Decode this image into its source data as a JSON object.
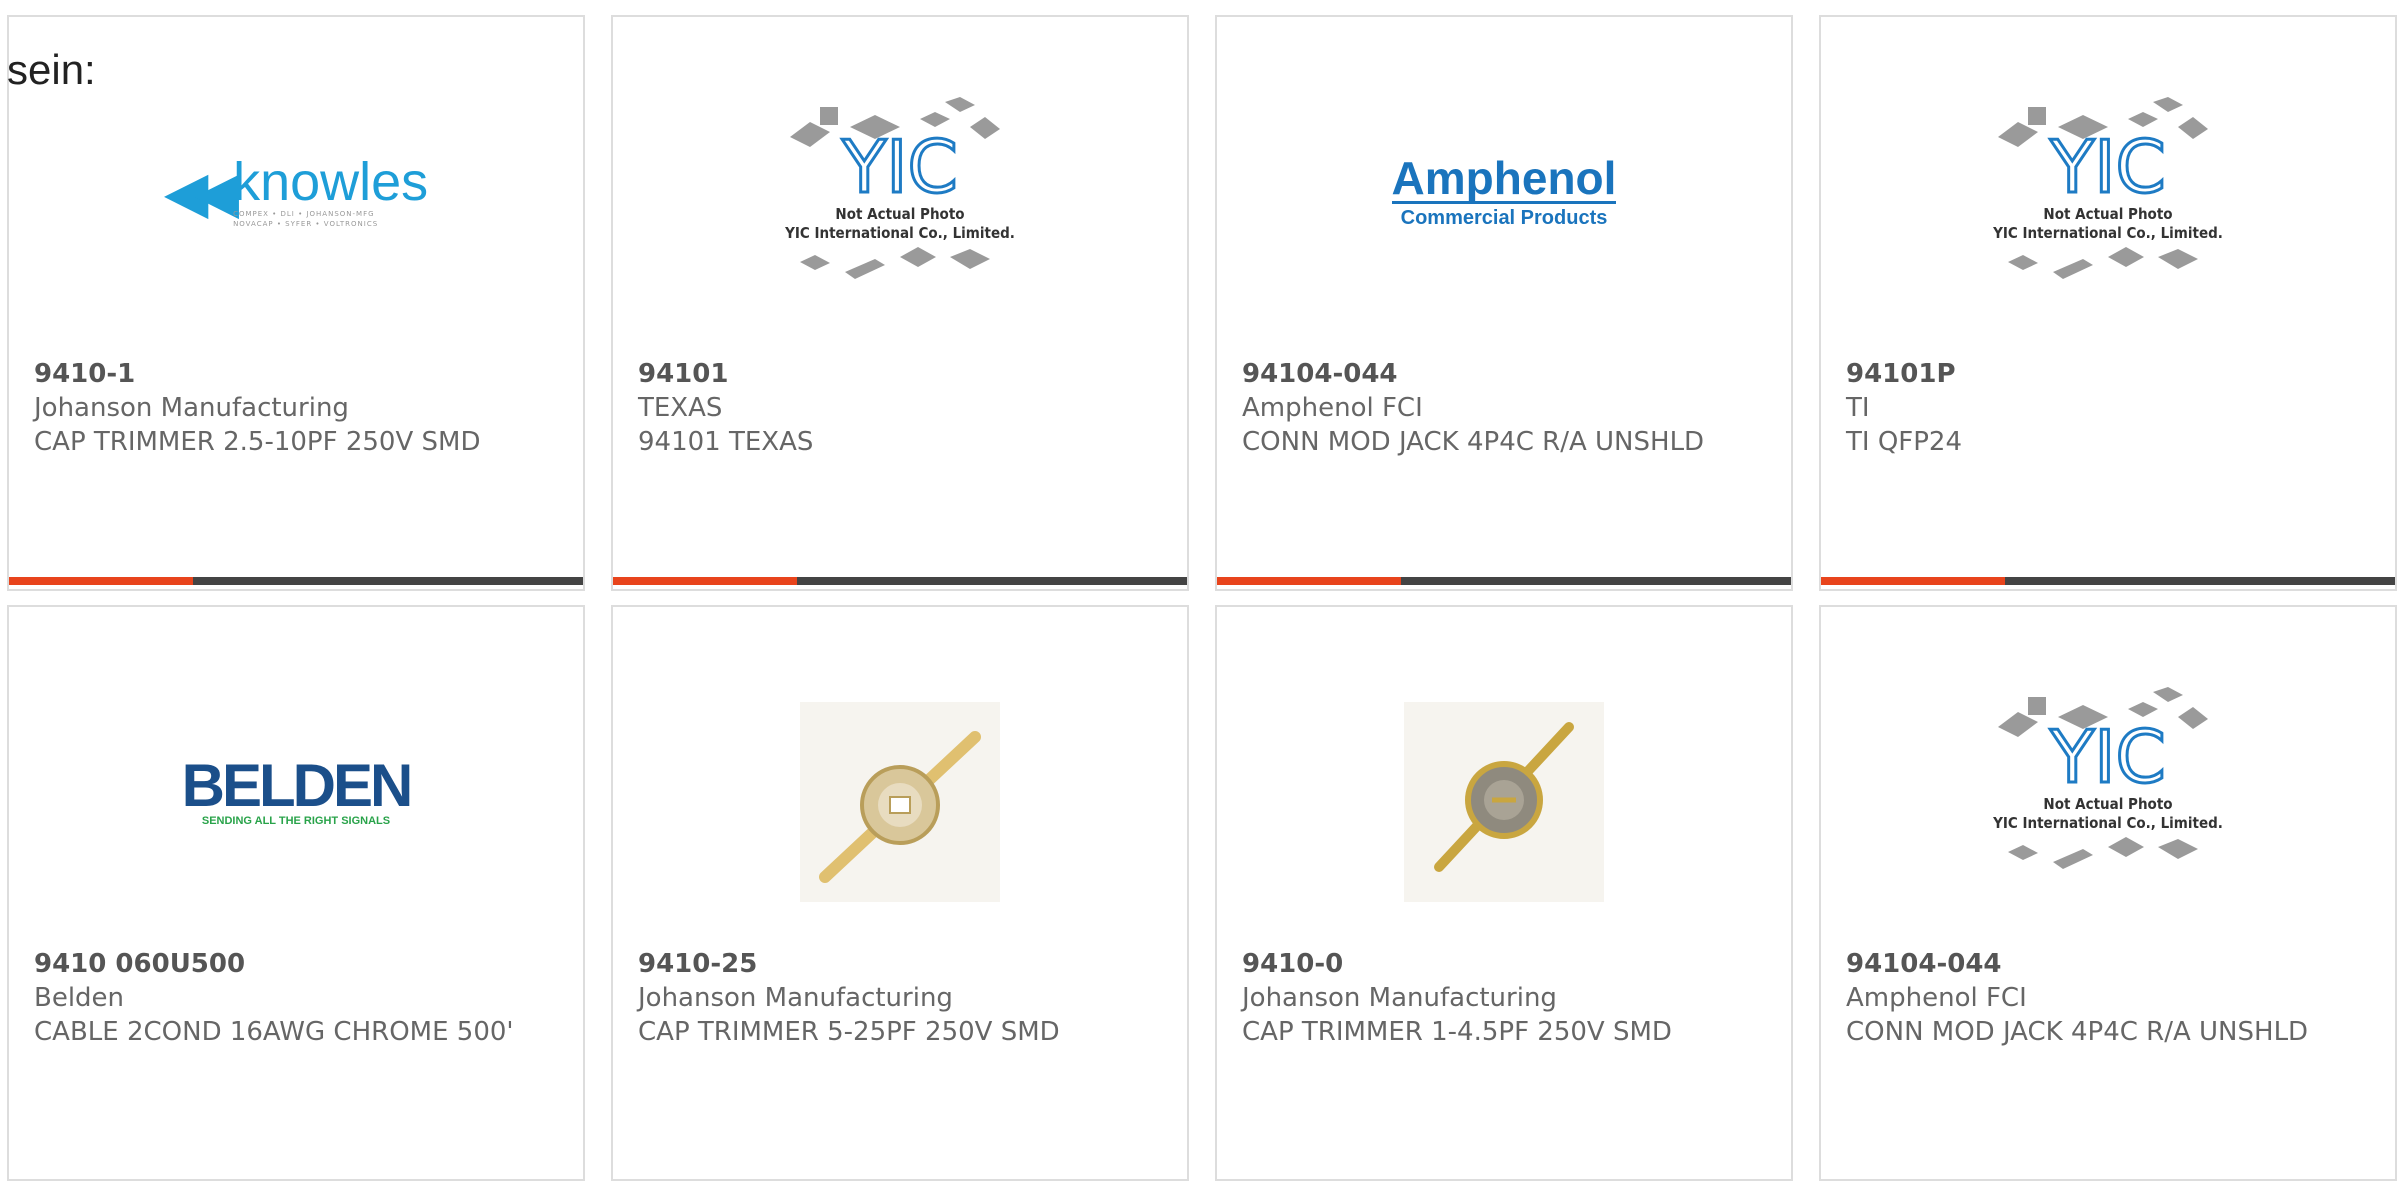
{
  "intro": "sein:",
  "accent_color": "#e8441c",
  "bar_color": "#444444",
  "placeholder": {
    "caption_line1": "Not Actual Photo",
    "caption_line2": "YIC International Co., Limited."
  },
  "logos": {
    "knowles": {
      "word": "knowles",
      "sub1": "COMPEX • DLI • JOHANSON-MFG",
      "sub2": "NOVACAP • SYFER • VOLTRONICS"
    },
    "amphenol": {
      "word": "Amphenol",
      "sub": "Commercial Products"
    },
    "belden": {
      "word": "BELDEN",
      "sub": "SENDING ALL THE RIGHT SIGNALS"
    }
  },
  "products": [
    {
      "part": "9410-1",
      "maker": "Johanson Manufacturing",
      "desc": "CAP TRIMMER 2.5-10PF 250V SMD",
      "image": "knowles-logo"
    },
    {
      "part": "94101",
      "maker": "TEXAS",
      "desc": "94101 TEXAS",
      "image": "yic-placeholder"
    },
    {
      "part": "94104-044",
      "maker": "Amphenol FCI",
      "desc": "CONN MOD JACK 4P4C R/A UNSHLD",
      "image": "amphenol-logo"
    },
    {
      "part": "94101P",
      "maker": "TI",
      "desc": "TI QFP24",
      "image": "yic-placeholder"
    },
    {
      "part": "9410 060U500",
      "maker": "Belden",
      "desc": "CABLE 2COND 16AWG CHROME 500'",
      "image": "belden-logo"
    },
    {
      "part": "9410-25",
      "maker": "Johanson Manufacturing",
      "desc": "CAP TRIMMER 5-25PF 250V SMD",
      "image": "trimmer-photo"
    },
    {
      "part": "9410-0",
      "maker": "Johanson Manufacturing",
      "desc": "CAP TRIMMER 1-4.5PF 250V SMD",
      "image": "trimmer-photo"
    },
    {
      "part": "94104-044",
      "maker": "Amphenol FCI",
      "desc": "CONN MOD JACK 4P4C R/A UNSHLD",
      "image": "yic-placeholder"
    }
  ]
}
